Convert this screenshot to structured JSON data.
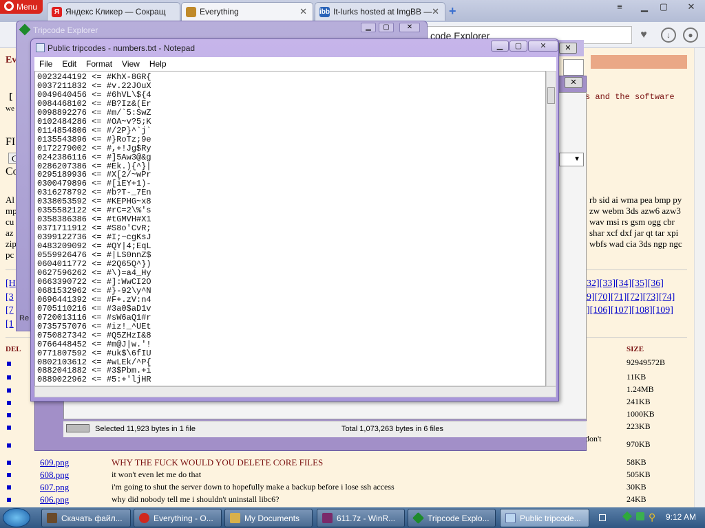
{
  "browser": {
    "menu_label": "Menu",
    "tabs": [
      {
        "label": "Яндекс Кликер — Сокращ",
        "icon": "yandex-icon",
        "color": "#e02020"
      },
      {
        "label": "Everything",
        "icon": "folder-icon",
        "color": "#c08a2a"
      },
      {
        "label": "It-lurks hosted at ImgBB —",
        "icon": "imgbb-icon",
        "color": "#2a63b8"
      }
    ],
    "address_text": "code Explorer",
    "new_tab": "+"
  },
  "page": {
    "header_left": "Ev",
    "bracket": "[",
    "we": "we",
    "fi": "FI",
    "co": "Co",
    "c": "C",
    "al": "Al",
    "mp": "mp",
    "cu": "cu",
    "az": "az",
    "zip": "zip",
    "pc": "pc",
    "right_line": "s and the software",
    "formats": [
      "rb sid ai wma pea bmp py",
      "zw webm 3ds azw6 azw3",
      "wav msi rs gsm ogg cbr",
      "shar xcf dxf jar qt tar xpi",
      "wbfs wad cia 3ds ngp ngc"
    ],
    "page_links_row1": "32][33][34][35][36]",
    "page_links_row2": "9][70][71][72][73][74]",
    "page_links_row3": "][106][107][108][109]",
    "left_links": [
      "[H",
      "[3",
      "[7",
      "[1"
    ],
    "table_header_del": "DEL",
    "table_header_size": "SIZE",
    "sizes": [
      "92949572B",
      "11KB",
      "1.24MB",
      "241KB",
      "1000KB",
      "223KB",
      "970KB"
    ],
    "dont": "don't",
    "rows": [
      {
        "file": "609.png",
        "comment": "WHY THE FUCK WOULD YOU DELETE CORE FILES",
        "size": "58KB"
      },
      {
        "file": "608.png",
        "comment": "it won't even let me do that",
        "size": "505KB"
      },
      {
        "file": "607.png",
        "comment": "i'm going to shut the server down to hopefully make a backup before i lose ssh access",
        "size": "30KB"
      },
      {
        "file": "606.png",
        "comment": "why did nobody tell me i shouldn't uninstall libc6?",
        "size": "24KB"
      }
    ]
  },
  "tripcode_window": {
    "title": "Tripcode Explorer"
  },
  "rar_window": {
    "status_left": "Selected 11,923 bytes in 1 file",
    "status_right": "Total 1,073,263 bytes in 6 files",
    "re": "Re"
  },
  "notepad": {
    "title": "Public tripcodes - numbers.txt - Notepad",
    "menu": [
      "File",
      "Edit",
      "Format",
      "View",
      "Help"
    ],
    "lines": [
      "0023244192 <= #KhX-8GR{",
      "0037211832 <= #v.22JOuX",
      "0049640456 <= #6hVL\\${4",
      "0084468102 <= #B?Iz&(Er",
      "0098892276 <= #m/`5:SwZ",
      "0102484286 <= #OA~v?5;K",
      "0114854806 <= #/2P}^`j`",
      "0135543896 <= #}RoTz;9e",
      "0172279002 <= #,+!Jg$Ry",
      "0242386116 <= #]5Aw3@&g",
      "0286207386 <= #Ek.){^}|",
      "0295189936 <= #X[2/~wPr",
      "0300479896 <= #[iEY+1)-",
      "0316278792 <= #b?T-_7En",
      "0338053592 <= #KEPHG~x8",
      "0355582122 <= #rC=2\\%'s",
      "0358386386 <= #tGMVH#X1",
      "0371711912 <= #S8o'CvR;",
      "0399122736 <= #I;~cgKsJ",
      "0483209092 <= #QY|4;EqL",
      "0559926476 <= #|LS0nnZ$",
      "0604011772 <= #2Q65Q^})",
      "0627596262 <= #\\)=a4_Hy",
      "0663390722 <= #]:WwCI2O",
      "0681532962 <= #}-92\\y^N",
      "0696441392 <= #F+.zV:n4",
      "0705110216 <= #3a0$aD1v",
      "0720013116 <= #sW6aQ1#r",
      "0735757076 <= #iz!_^UEt",
      "0750827342 <= #Q5ZHzI&8",
      "0766448452 <= #m@J|w.'!",
      "0771807592 <= #uk$\\6fIU",
      "0802103612 <= #wLEk/^P{",
      "0882041882 <= #3$Pbm.+i",
      "0889022962 <= #5:+'ljHR"
    ]
  },
  "taskbar": {
    "items": [
      {
        "label": "Скачать файл...",
        "color": "#6a4a2a"
      },
      {
        "label": "Everything - O...",
        "color": "#d0281e"
      },
      {
        "label": "My Documents",
        "color": "#d8b04a"
      },
      {
        "label": "611.7z - WinR...",
        "color": "#7a2a6a"
      },
      {
        "label": "Tripcode Explo...",
        "color": "#1e8a2c"
      },
      {
        "label": "Public tripcode...",
        "color": "#bcd6f0"
      }
    ],
    "clock": "9:12 AM"
  }
}
